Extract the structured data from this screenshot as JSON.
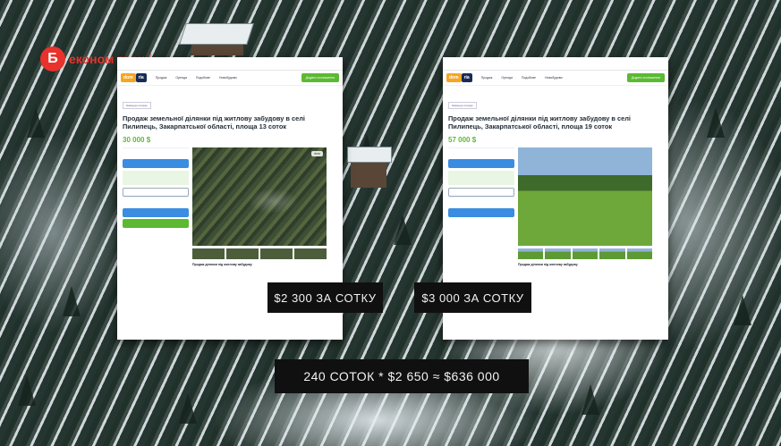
{
  "logo": {
    "badge": "Б",
    "text": "економ гроші"
  },
  "captions": {
    "left": "$2 300 ЗА СОТКУ",
    "right": "$3 000 ЗА СОТКУ",
    "bottom": "240 СОТОК * $2 650 ≈ $636 000"
  },
  "site": {
    "brand_a": "dom",
    "brand_b": "ria",
    "nav": [
      "Продаж",
      "Оренда",
      "Подобове",
      "Новобудови"
    ],
    "add_button": "Додати оголошення",
    "back": "Назад до пошуку"
  },
  "listing_left": {
    "title": "Продаж земельної ділянки під житлову забудову в селі Пилипець, Закарпатської області, площа 13 соток",
    "price": "30 000 $",
    "desc_title": "Продаж ділянки під житлову забудову"
  },
  "listing_right": {
    "title": "Продаж земельної ділянки під житлову забудову в селі Пилипець, Закарпатської області, площа 19 соток",
    "price": "57 000 $",
    "desc_title": "Продаж ділянки під житлову забудову"
  },
  "colors": {
    "accent_red": "#e8322b",
    "price_green": "#5cb932",
    "caption_bg": "#101010"
  }
}
